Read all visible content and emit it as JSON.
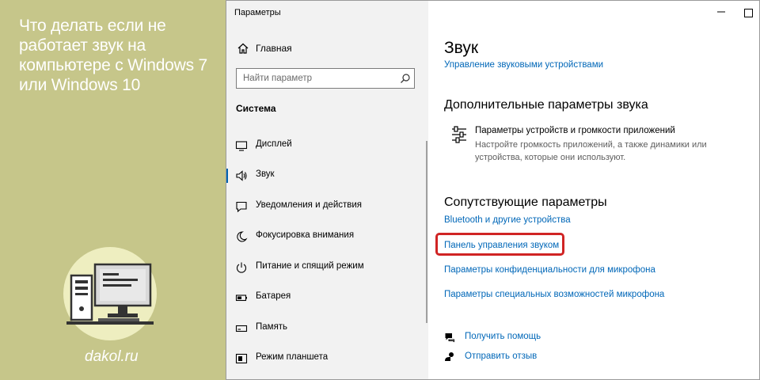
{
  "article": {
    "title": "Что делать если не работает звук на компьютере с Windows 7 или Windows 10",
    "site": "dakol.ru"
  },
  "window": {
    "title": "Параметры",
    "controls": [
      "minimize-icon",
      "maximize-icon"
    ]
  },
  "nav": {
    "home_label": "Главная",
    "search_placeholder": "Найти параметр",
    "section_label": "Система",
    "items": [
      {
        "label": "Дисплей",
        "icon": "display-icon"
      },
      {
        "label": "Звук",
        "icon": "speaker-icon",
        "active": true
      },
      {
        "label": "Уведомления и действия",
        "icon": "notification-icon"
      },
      {
        "label": "Фокусировка внимания",
        "icon": "moon-icon"
      },
      {
        "label": "Питание и спящий режим",
        "icon": "power-icon"
      },
      {
        "label": "Батарея",
        "icon": "battery-icon"
      },
      {
        "label": "Память",
        "icon": "storage-icon"
      },
      {
        "label": "Режим планшета",
        "icon": "tablet-mode-icon"
      }
    ]
  },
  "content": {
    "title": "Звук",
    "manage_devices_link": "Управление звуковыми устройствами",
    "advanced_heading": "Дополнительные параметры звука",
    "device_volume_title": "Параметры устройств и громкости приложений",
    "device_volume_desc": "Настройте громкость приложений, а также динамики или устройства, которые они используют.",
    "related_heading": "Сопутствующие параметры",
    "related_links": [
      "Bluetooth и другие устройства",
      "Панель управления звуком",
      "Параметры конфиденциальности для микрофона",
      "Параметры специальных возможностей микрофона"
    ],
    "help_link": "Получить помощь",
    "feedback_link": "Отправить отзыв"
  },
  "colors": {
    "left_background": "#c6c68a",
    "link": "#0067b8",
    "highlight": "#d02424",
    "accent": "#0063b1"
  }
}
